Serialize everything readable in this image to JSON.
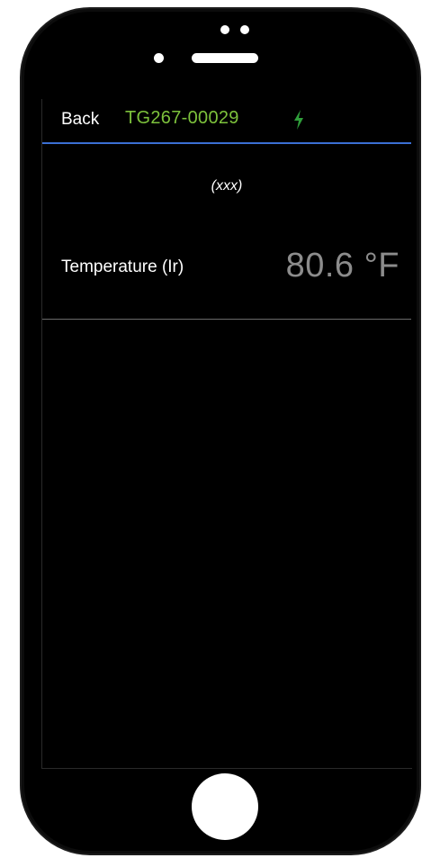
{
  "navbar": {
    "back_label": "Back",
    "device_id": "TG267-00029",
    "status_icon": "lightning-bolt-icon",
    "device_id_color": "#7dc23c",
    "accent_line_color": "#3b6fd4"
  },
  "content": {
    "subtitle": "(xxx)",
    "reading": {
      "label": "Temperature (Ir)",
      "value": "80.6 °F"
    }
  }
}
